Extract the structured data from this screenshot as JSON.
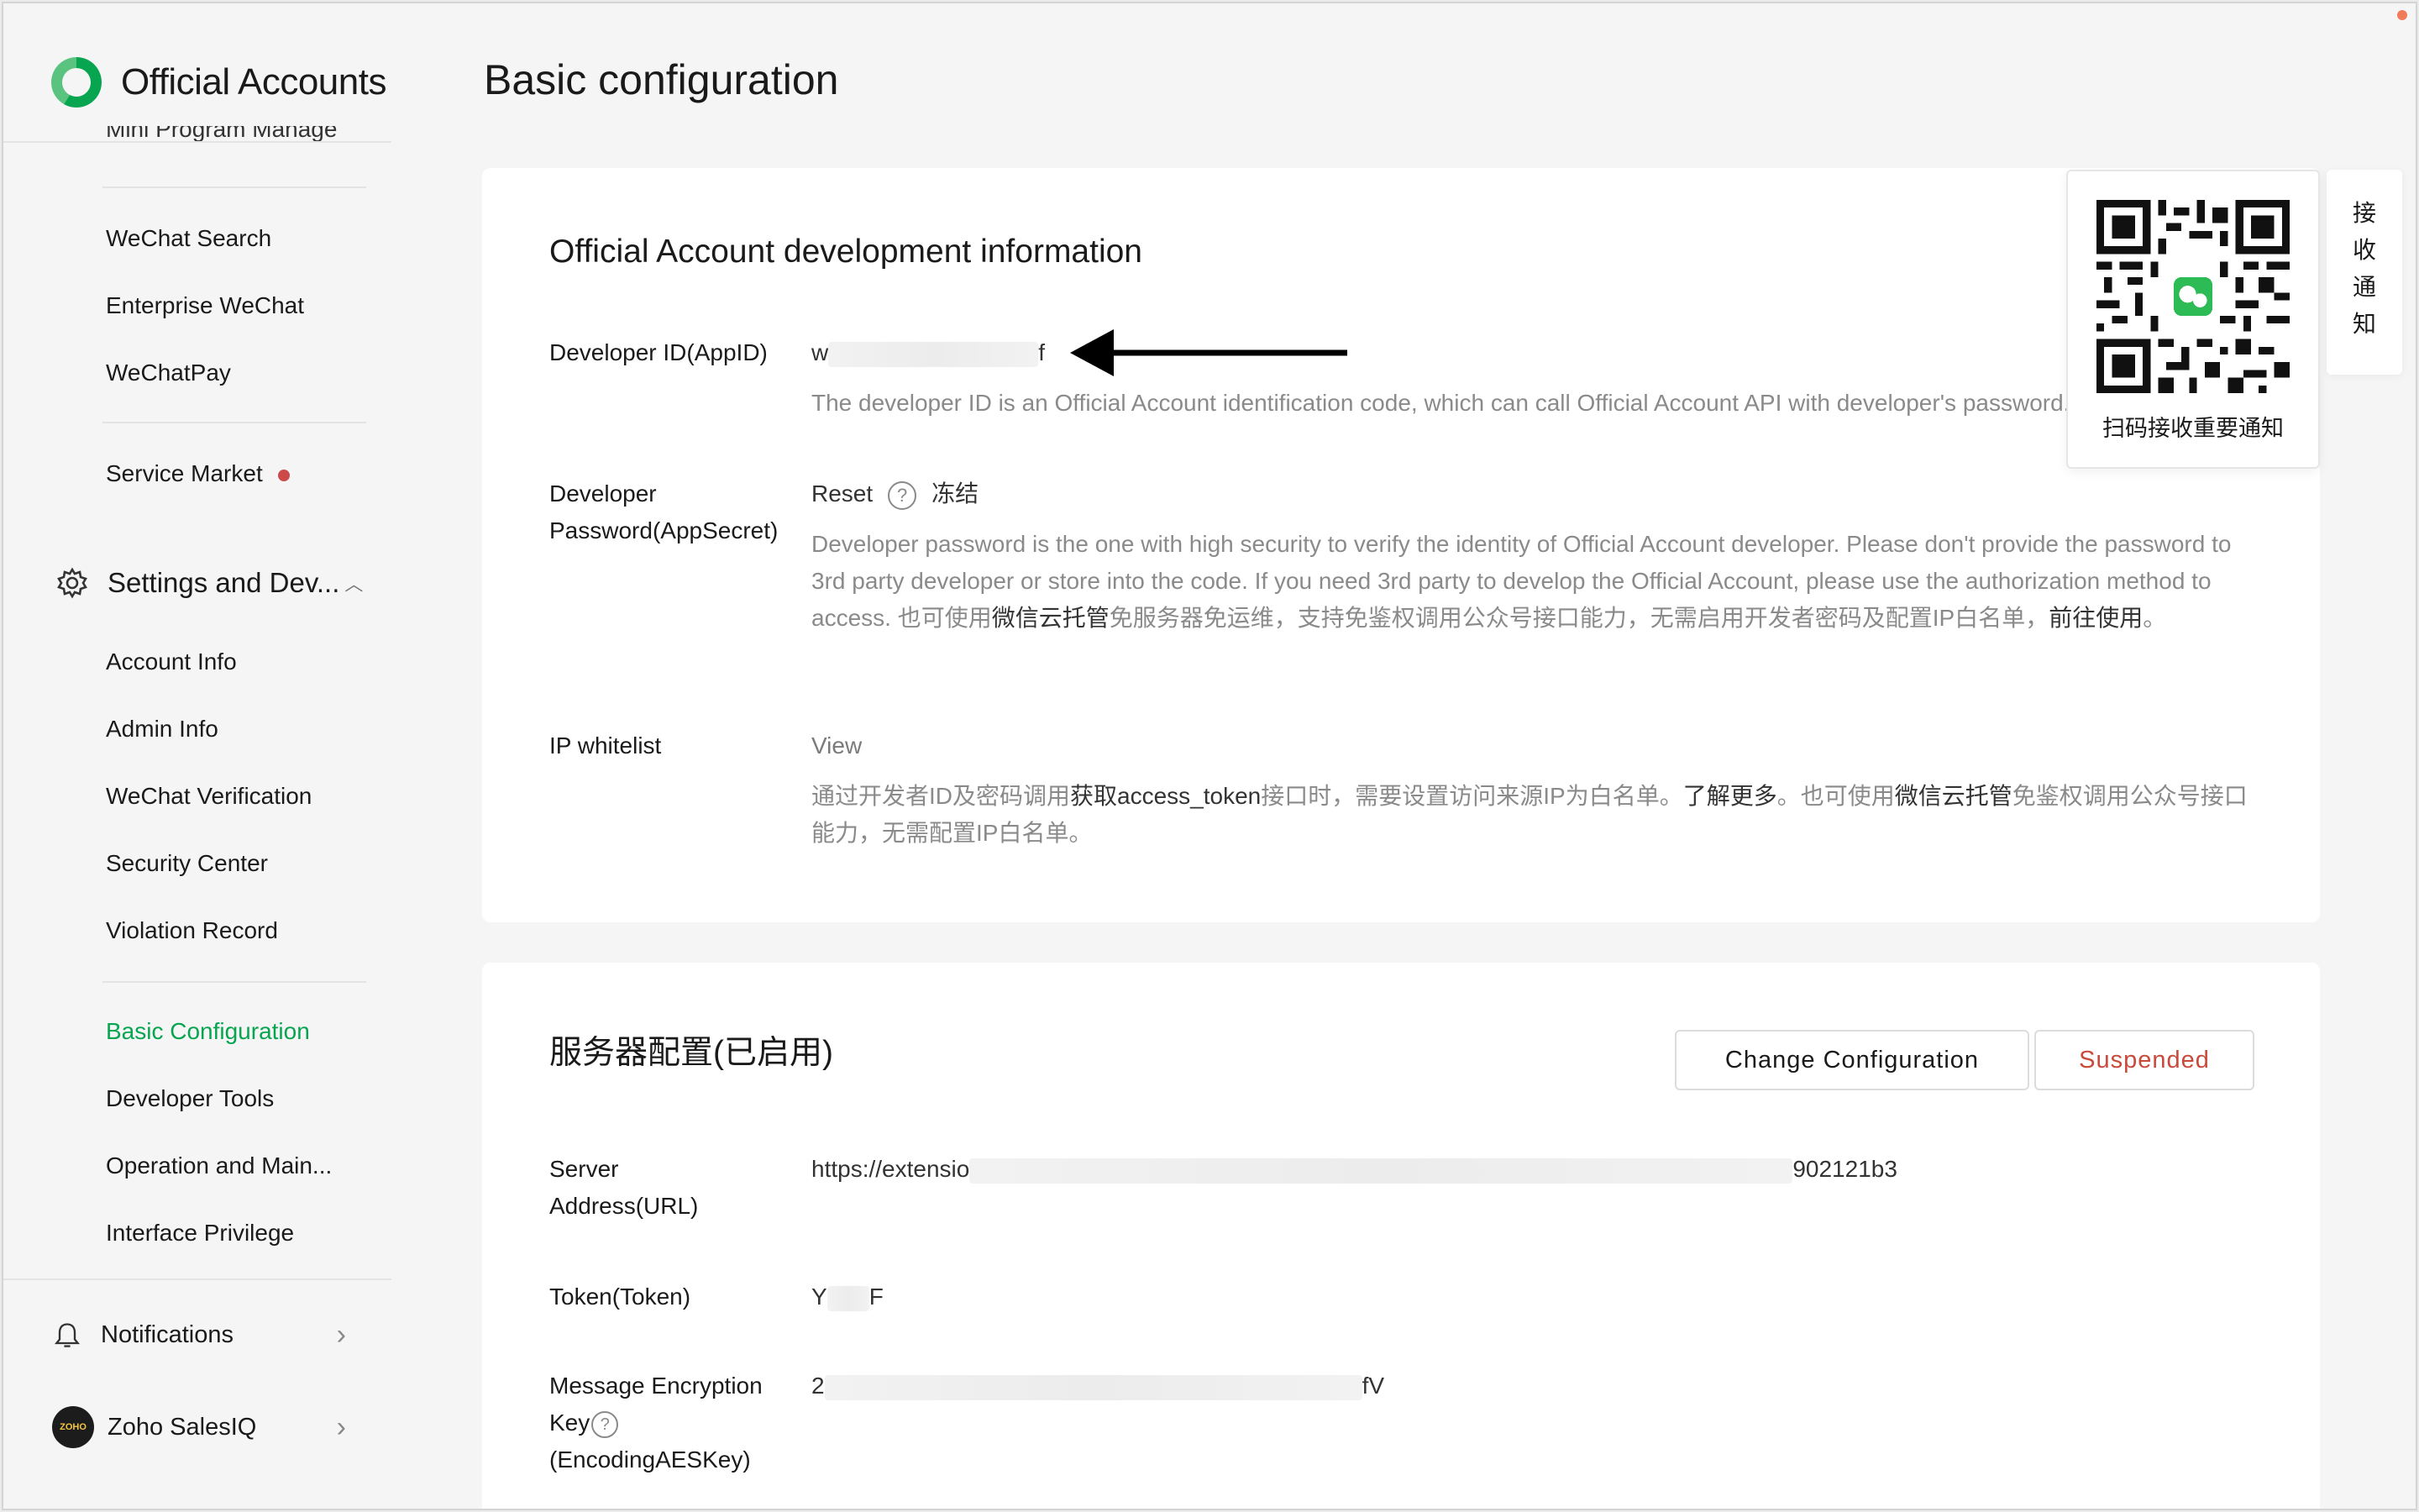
{
  "app": {
    "name": "Official Accounts"
  },
  "sidebar": {
    "clipped_item": "Mini Program Manage",
    "group1": [
      {
        "label": "WeChat Search"
      },
      {
        "label": "Enterprise WeChat"
      },
      {
        "label": "WeChatPay"
      }
    ],
    "service_market": {
      "label": "Service Market"
    },
    "settings_section": {
      "label": "Settings and Dev..."
    },
    "settings_items": [
      {
        "label": "Account Info"
      },
      {
        "label": "Admin Info"
      },
      {
        "label": "WeChat Verification"
      },
      {
        "label": "Security Center"
      },
      {
        "label": "Violation Record"
      }
    ],
    "dev_items": [
      {
        "label": "Basic Configuration",
        "active": true
      },
      {
        "label": "Developer Tools"
      },
      {
        "label": "Operation and Main..."
      },
      {
        "label": "Interface Privilege"
      }
    ],
    "notifications": {
      "label": "Notifications"
    },
    "account": {
      "label": "Zoho SalesIQ",
      "avatar_text": "ZOHO"
    }
  },
  "page": {
    "title": "Basic configuration"
  },
  "dev_info": {
    "title": "Official Account development information",
    "app_id": {
      "label": "Developer ID(AppID)",
      "value_prefix": "w",
      "value_suffix": "f",
      "desc": "The developer ID is an Official Account identification code, which can call Official Account API with developer's password."
    },
    "app_secret": {
      "label": "Developer Password(AppSecret)",
      "reset": "Reset",
      "freeze": "冻结",
      "desc_part1": "Developer password is the one with high security to verify the identity of Official Account developer. Please don't provide the password to 3rd party developer or store into the code. If you need 3rd party to develop the Official Account, please use the authorization method to access. 也可使用",
      "desc_link1": "微信云托管",
      "desc_part2": "免服务器免运维，支持免鉴权调用公众号接口能力，无需启用开发者密码及配置IP白名单，",
      "desc_link2": "前往使用",
      "desc_part3": "。"
    },
    "ip_whitelist": {
      "label": "IP whitelist",
      "view": "View",
      "desc_part1": "通过开发者ID及密码调用",
      "desc_link1": "获取access_token",
      "desc_part2": "接口时，需要设置访问来源IP为白名单。",
      "desc_link2": "了解更多",
      "desc_part3": "。也可使用",
      "desc_link3": "微信云托管",
      "desc_part4": "免鉴权调用公众号接口能力，无需配置IP白名单。"
    }
  },
  "qr_popup": {
    "caption": "扫码接收重要通知"
  },
  "notify_tab": {
    "chars": [
      "接",
      "收",
      "通",
      "知"
    ]
  },
  "server_config": {
    "title": "服务器配置(已启用)",
    "change_button": "Change Configuration",
    "suspend_button": "Suspended",
    "url": {
      "label": "Server Address(URL)",
      "value_prefix": "https://extensio",
      "value_suffix": "902121b3"
    },
    "token": {
      "label": "Token(Token)",
      "value_prefix": "Y",
      "value_suffix": "F"
    },
    "aes_key": {
      "label_part1": "Message Encryption Key",
      "label_part2": "(EncodingAESKey)",
      "value_prefix": "2",
      "value_suffix": "fV"
    }
  },
  "colors": {
    "accent_green": "#07a550",
    "danger": "#c84a3a",
    "notice_dot": "#cd4a4a"
  },
  "icons": [
    "wechat-logo-icon",
    "gear-icon",
    "bell-icon",
    "chevron-right-icon",
    "help-circle-icon",
    "arrow-left-icon",
    "qr-code-icon"
  ]
}
